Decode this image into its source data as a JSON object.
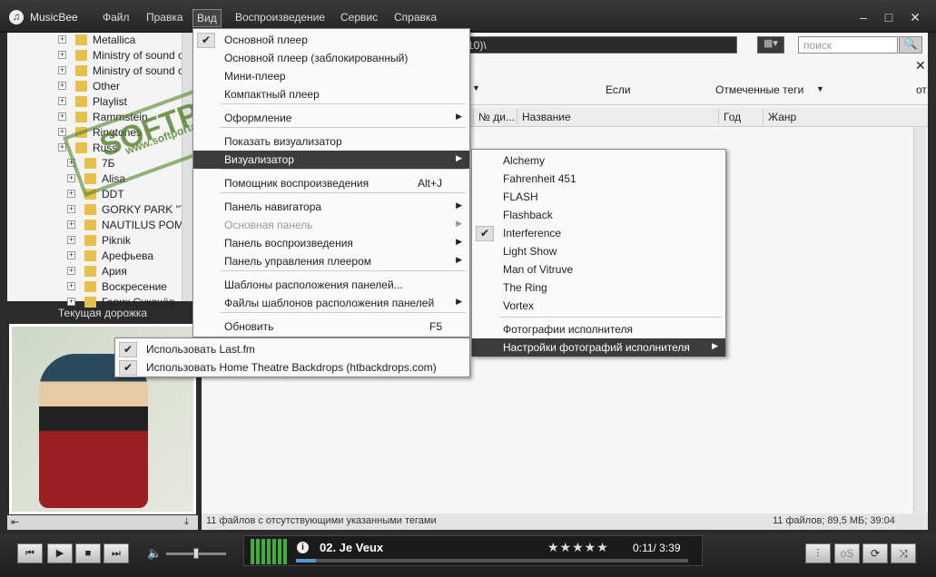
{
  "app": {
    "title": "MusicBee",
    "logo_letter": "♫"
  },
  "menubar": [
    "Файл",
    "Правка",
    "Вид",
    "Воспроизведение",
    "Сервис",
    "Справка"
  ],
  "window_controls": {
    "min": "–",
    "max": "□",
    "close": "✕"
  },
  "tree": [
    "Metallica",
    "Ministry of sound c",
    "Ministry of sound c",
    "Other",
    "Playlist",
    "Rammstein",
    "Ringtones",
    "Russ",
    "7Б",
    "Alisa",
    "DDT",
    "GORKY PARK ''TH",
    "NAUTILUS POMP",
    "Piknik",
    "Арефьева",
    "Ария",
    "Воскресение",
    "Гарик Сукачёв"
  ],
  "current_track_header": "Текущая дорожка",
  "path_value": "10)\\",
  "search": {
    "placeholder": "поиск"
  },
  "filter": {
    "if_label": "Если",
    "marked_tags": "Отмеченные теги",
    "cut_label": "от"
  },
  "columns": [
    "№ ди...",
    "Название",
    "Год",
    "Жанр"
  ],
  "status": {
    "left": "11 файлов с отсутствующими указанными тегами",
    "right": "11 файлов; 89,5 МБ; 39:04"
  },
  "view_menu": [
    {
      "label": "Основной плеер",
      "checked": true
    },
    {
      "label": "Основной плеер (заблокированный)"
    },
    {
      "label": "Мини-плеер"
    },
    {
      "label": "Компактный плеер"
    },
    {
      "label": "Оформление",
      "sub": true
    },
    {
      "label": "Показать визуализатор"
    },
    {
      "label": "Визуализатор",
      "sub": true,
      "highlight": true
    },
    {
      "label": "Помощник воспроизведения",
      "shortcut": "Alt+J"
    },
    {
      "label": "Панель навигатора",
      "sub": true
    },
    {
      "label": "Основная панель",
      "sub": true,
      "disabled": true
    },
    {
      "label": "Панель воспроизведения",
      "sub": true
    },
    {
      "label": "Панель управления плеером",
      "sub": true
    },
    {
      "label": "Шаблоны расположения панелей..."
    },
    {
      "label": "Файлы шаблонов расположения панелей",
      "sub": true
    },
    {
      "label": "Обновить",
      "shortcut": "F5"
    }
  ],
  "visualizer_menu": [
    "Alchemy",
    "Fahrenheit 451",
    "FLASH",
    "Flashback",
    "Interference",
    "Light Show",
    "Man of Vitruve",
    "The Ring",
    "Vortex"
  ],
  "visualizer_checked": "Interference",
  "artist_photos": "Фотографии исполнителя",
  "artist_photo_settings": "Настройки фотографий исполнителя",
  "photo_settings_menu": [
    {
      "label": "Использовать Last.fm",
      "checked": true
    },
    {
      "label": "Использовать Home Theatre Backdrops (htbackdrops.com)",
      "checked": true
    }
  ],
  "player": {
    "track": "02. Je Veux",
    "time": "0:11/ 3:39",
    "stars": "★★★★★",
    "progress": 0.05,
    "volume": 0.45
  },
  "watermark": {
    "text": "SOFTPORTAL",
    "url": "www.softportal.com"
  }
}
